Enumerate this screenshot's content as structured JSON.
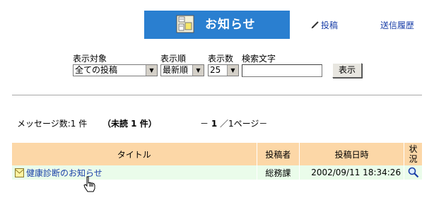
{
  "header": {
    "title": "お知らせ",
    "banner_color": "#2a7fd0"
  },
  "links": {
    "post": "投稿",
    "sent_history": "送信履歴"
  },
  "filters": {
    "target": {
      "label": "表示対象",
      "value": "全ての投稿"
    },
    "order": {
      "label": "表示順",
      "value": "最新順"
    },
    "count": {
      "label": "表示数",
      "value": "25"
    },
    "search": {
      "label": "検索文字",
      "value": ""
    },
    "button": "表示"
  },
  "summary": {
    "message_count": "メッセージ数:1 件",
    "unread": "（未読 1 件）",
    "pager_prefix": "－",
    "current_page": "1",
    "pager_suffix": "／1ページ－"
  },
  "table": {
    "headers": {
      "title": "タイトル",
      "poster": "投稿者",
      "date": "投稿日時",
      "status": "状況"
    },
    "rows": [
      {
        "title": "健康診断のお知らせ",
        "poster": "総務課",
        "date": "2002/09/11 18:34:26",
        "status_icon": "magnifier-icon"
      }
    ],
    "header_color": "#fcd7a7",
    "row_color": "#eafcea"
  }
}
